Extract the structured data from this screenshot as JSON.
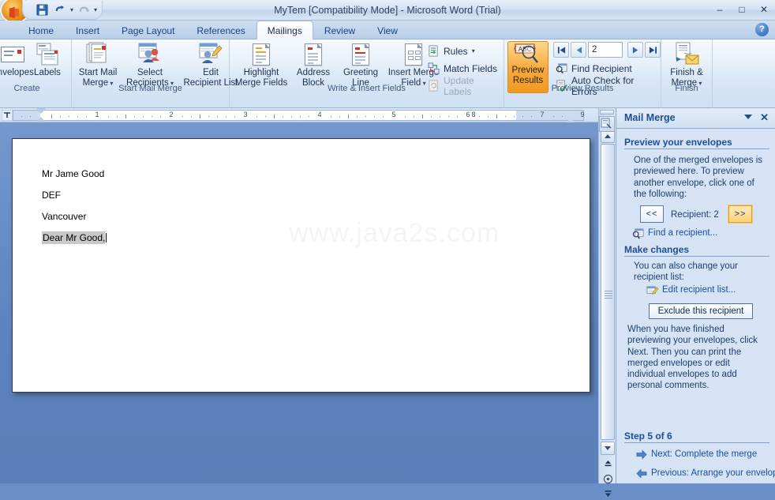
{
  "window": {
    "title": "MyTem [Compatibility Mode]  -  Microsoft Word (Trial)",
    "minimize": "–",
    "maximize": "□",
    "close": "✕"
  },
  "quick_access": {
    "save_icon": "save-icon",
    "undo_icon": "undo-icon",
    "redo_icon": "redo-icon",
    "customize_icon": "customize-icon"
  },
  "tabs": [
    {
      "label": "Home",
      "active": false
    },
    {
      "label": "Insert",
      "active": false
    },
    {
      "label": "Page Layout",
      "active": false
    },
    {
      "label": "References",
      "active": false
    },
    {
      "label": "Mailings",
      "active": true
    },
    {
      "label": "Review",
      "active": false
    },
    {
      "label": "View",
      "active": false
    }
  ],
  "help_label": "?",
  "ribbon": {
    "groups": [
      {
        "name": "Create",
        "label": "Create",
        "buttons": [
          {
            "label": "Envelopes",
            "icon": "envelope-icon"
          },
          {
            "label": "Labels",
            "icon": "labels-icon"
          }
        ]
      },
      {
        "name": "Start Mail Merge",
        "label": "Start Mail Merge",
        "buttons": [
          {
            "label_line1": "Start Mail",
            "label_line2": "Merge",
            "icon": "start-mail-merge-icon",
            "dropdown": true
          },
          {
            "label_line1": "Select",
            "label_line2": "Recipients",
            "icon": "select-recipients-icon",
            "dropdown": true
          },
          {
            "label_line1": "Edit",
            "label_line2": "Recipient List",
            "icon": "edit-recipient-list-icon",
            "dropdown": false
          }
        ]
      },
      {
        "name": "Write & Insert Fields",
        "label": "Write & Insert Fields",
        "buttons": [
          {
            "label_line1": "Highlight",
            "label_line2": "Merge Fields",
            "icon": "highlight-merge-fields-icon"
          },
          {
            "label_line1": "Address",
            "label_line2": "Block",
            "icon": "address-block-icon"
          },
          {
            "label_line1": "Greeting",
            "label_line2": "Line",
            "icon": "greeting-line-icon"
          },
          {
            "label_line1": "Insert Merge",
            "label_line2": "Field",
            "icon": "insert-merge-field-icon",
            "dropdown": true
          }
        ],
        "small_buttons": [
          {
            "label": "Rules",
            "icon": "rules-icon",
            "dropdown": true,
            "enabled": true
          },
          {
            "label": "Match Fields",
            "icon": "match-fields-icon",
            "dropdown": false,
            "enabled": true
          },
          {
            "label": "Update Labels",
            "icon": "update-labels-icon",
            "dropdown": false,
            "enabled": false
          }
        ]
      },
      {
        "name": "Preview Results",
        "label": "Preview Results",
        "preview_button": {
          "label_line1": "Preview",
          "label_line2": "Results",
          "icon": "preview-results-icon",
          "active": true
        },
        "record_nav": {
          "first_icon": "first-record-icon",
          "prev_icon": "previous-record-icon",
          "record_value": "2",
          "next_icon": "next-record-icon",
          "last_icon": "last-record-icon"
        },
        "small_buttons": [
          {
            "label": "Find Recipient",
            "icon": "find-recipient-icon",
            "enabled": true
          },
          {
            "label": "Auto Check for Errors",
            "icon": "auto-check-errors-icon",
            "enabled": true
          }
        ]
      },
      {
        "name": "Finish",
        "label": "Finish",
        "buttons": [
          {
            "label_line1": "Finish &",
            "label_line2": "Merge",
            "icon": "finish-merge-icon",
            "dropdown": true
          }
        ]
      }
    ]
  },
  "ruler": {
    "numbers": [
      "1",
      "2",
      "3",
      "4",
      "5",
      "6",
      "7",
      "8",
      "9"
    ],
    "tab_stop_icon": "tab-stop-selector-icon",
    "left_indent_icon": "left-indent-marker",
    "right_indent_icon": "right-indent-marker"
  },
  "document": {
    "lines": [
      {
        "text": "Mr Jame Good",
        "highlighted": false
      },
      {
        "text": "DEF",
        "highlighted": false
      },
      {
        "text": "Vancouver",
        "highlighted": false
      },
      {
        "text": "Dear Mr Good,",
        "highlighted": true
      }
    ],
    "watermark": "www.java2s.com"
  },
  "scrollbar": {
    "up_icon": "scroll-up-icon",
    "down_icon": "scroll-down-icon",
    "prev_page_icon": "previous-page-icon",
    "select_object_icon": "select-browse-object-icon",
    "next_page_icon": "next-page-icon"
  },
  "task_pane": {
    "title": "Mail Merge",
    "dropdown_icon": "task-pane-menu-icon",
    "close_icon": "close-icon",
    "section1_heading": "Preview your envelopes",
    "section1_text": "One of the merged envelopes is previewed here. To preview another envelope, click one of the following:",
    "prev_recipient_label": "<<",
    "recipient_label": "Recipient: 2",
    "next_recipient_label": ">>",
    "find_recipient_link": "Find a recipient...",
    "section2_heading": "Make changes",
    "section2_text": "You can also change your recipient list:",
    "edit_recipient_link": "Edit recipient list...",
    "exclude_button": "Exclude this recipient",
    "section2_footer": "When you have finished previewing your envelopes, click Next. Then you can print the merged envelopes or edit individual envelopes to add personal comments.",
    "step_label": "Step 5 of 6",
    "next_link": "Next: Complete the merge",
    "previous_link": "Previous: Arrange your envelope"
  },
  "colors": {
    "accent_blue": "#1d4f91",
    "link_blue": "#1a4fa0",
    "ribbon_bg": "#e6eff9",
    "desktop_blue": "#5c82bd",
    "highlight_orange": "#ffd27a",
    "merge_field_gray": "#c9c9c9"
  }
}
